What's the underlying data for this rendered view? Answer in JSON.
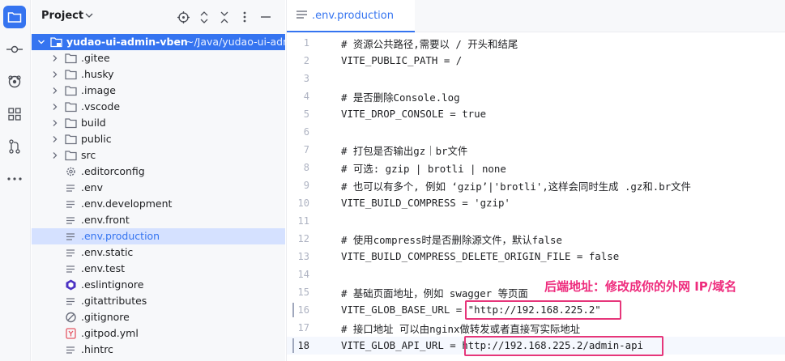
{
  "project_panel": {
    "title": "Project",
    "root": {
      "name": "yudao-ui-admin-vben",
      "path": "~/Java/yudao-ui-adm"
    },
    "items": [
      {
        "label": ".gitee",
        "kind": "folder"
      },
      {
        "label": ".husky",
        "kind": "folder"
      },
      {
        "label": ".image",
        "kind": "folder"
      },
      {
        "label": ".vscode",
        "kind": "folder"
      },
      {
        "label": "build",
        "kind": "folder"
      },
      {
        "label": "public",
        "kind": "folder"
      },
      {
        "label": "src",
        "kind": "folder"
      },
      {
        "label": ".editorconfig",
        "kind": "gear"
      },
      {
        "label": ".env",
        "kind": "text"
      },
      {
        "label": ".env.development",
        "kind": "text"
      },
      {
        "label": ".env.front",
        "kind": "text"
      },
      {
        "label": ".env.production",
        "kind": "text",
        "selected": true
      },
      {
        "label": ".env.static",
        "kind": "text"
      },
      {
        "label": ".env.test",
        "kind": "text"
      },
      {
        "label": ".eslintignore",
        "kind": "eslint"
      },
      {
        "label": ".gitattributes",
        "kind": "text"
      },
      {
        "label": ".gitignore",
        "kind": "ignore"
      },
      {
        "label": ".gitpod.yml",
        "kind": "yaml"
      },
      {
        "label": ".hintrc",
        "kind": "text"
      }
    ]
  },
  "editor": {
    "tab_label": ".env.production",
    "lines": [
      {
        "n": "1",
        "text": "# 资源公共路径,需要以 / 开头和结尾"
      },
      {
        "n": "2",
        "text": "VITE_PUBLIC_PATH = /"
      },
      {
        "n": "3",
        "text": ""
      },
      {
        "n": "4",
        "text": "# 是否删除Console.log"
      },
      {
        "n": "5",
        "text": "VITE_DROP_CONSOLE = true"
      },
      {
        "n": "6",
        "text": ""
      },
      {
        "n": "7",
        "text": "# 打包是否输出gz｜br文件"
      },
      {
        "n": "8",
        "text": "# 可选: gzip | brotli | none"
      },
      {
        "n": "9",
        "text": "# 也可以有多个, 例如 ‘gzip’|'brotli',这样会同时生成 .gz和.br文件"
      },
      {
        "n": "10",
        "text": "VITE_BUILD_COMPRESS = 'gzip'"
      },
      {
        "n": "11",
        "text": ""
      },
      {
        "n": "12",
        "text": "# 使用compress时是否删除源文件，默认false"
      },
      {
        "n": "13",
        "text": "VITE_BUILD_COMPRESS_DELETE_ORIGIN_FILE = false"
      },
      {
        "n": "14",
        "text": ""
      },
      {
        "n": "15",
        "text": "# 基础页面地址，例如 swagger 等页面"
      },
      {
        "n": "16",
        "text": "VITE_GLOB_BASE_URL = \"http://192.168.225.2\""
      },
      {
        "n": "17",
        "text": "# 接口地址 可以由nginx做转发或者直接写实际地址"
      },
      {
        "n": "18",
        "text": "VITE_GLOB_API_URL = http://192.168.225.2/admin-api"
      }
    ]
  },
  "annotation": "后端地址：修改成你的外网 IP/域名",
  "colors": {
    "accent": "#3574f0",
    "annotation": "#ee2c7d"
  }
}
